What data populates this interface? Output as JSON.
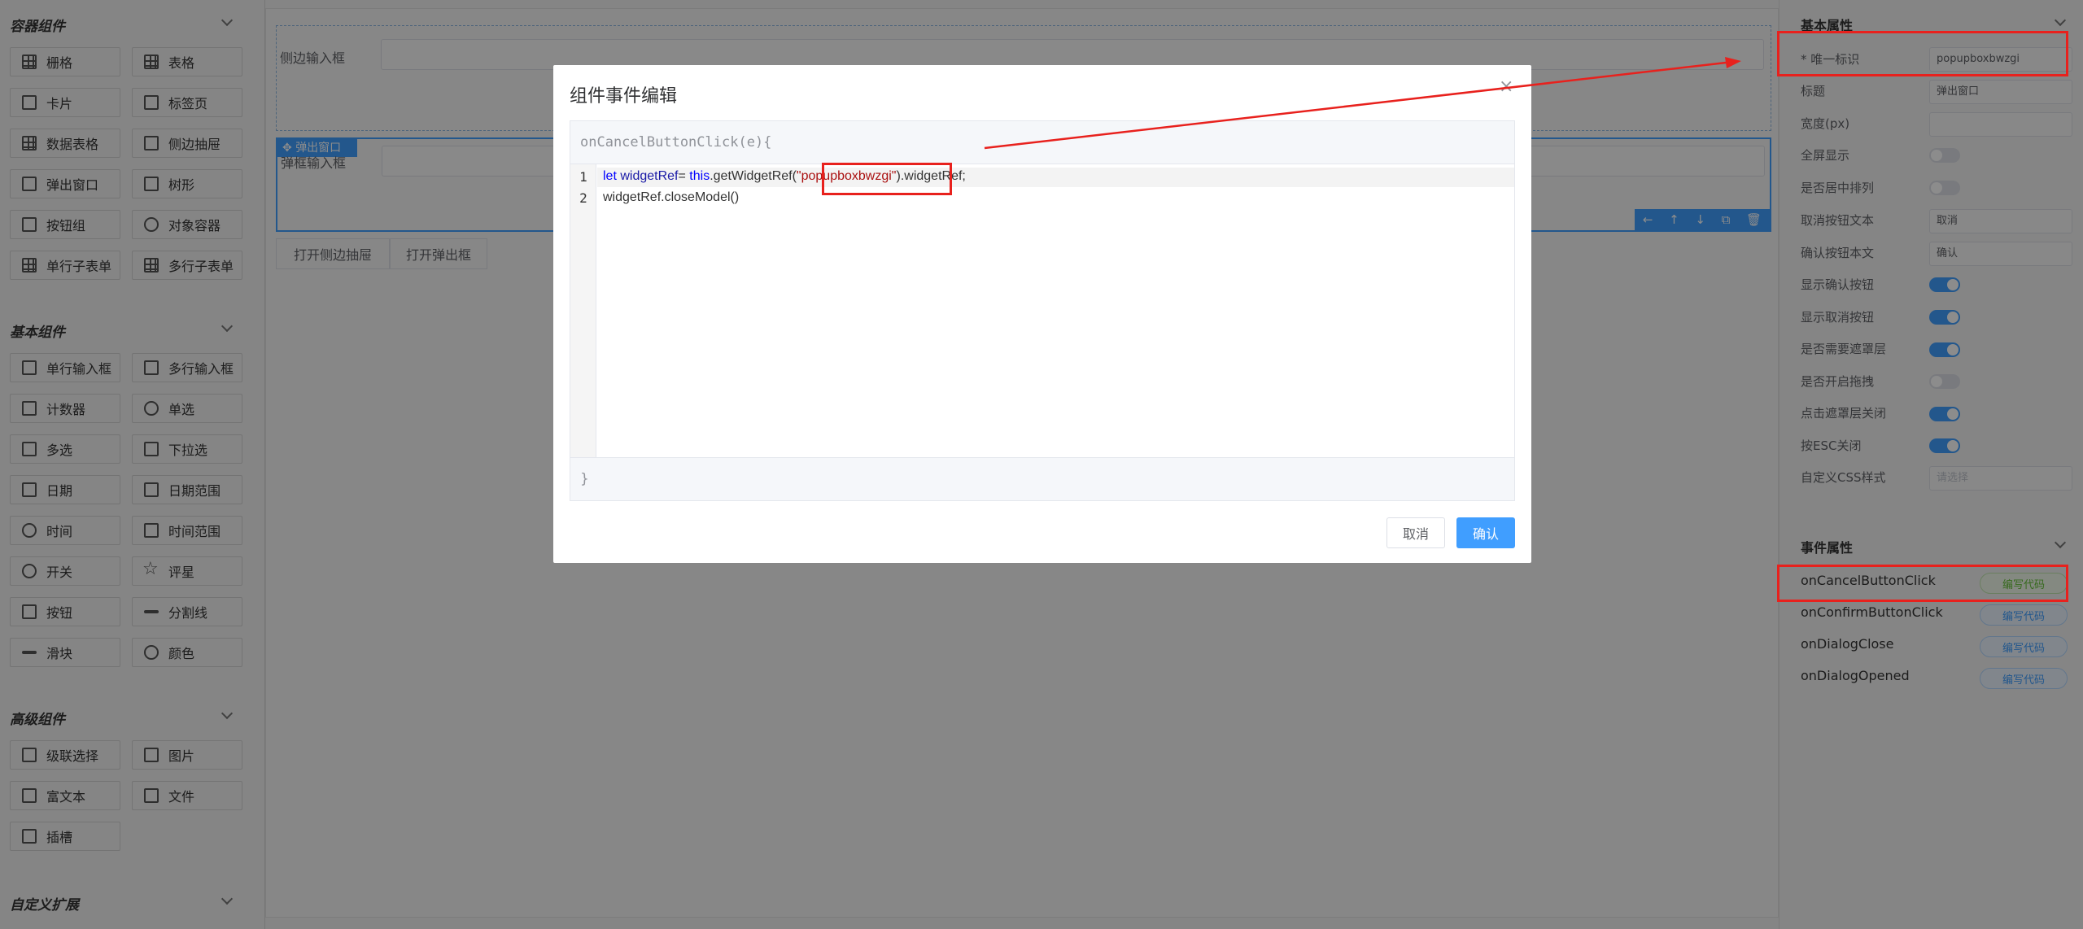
{
  "left_panel": {
    "sections": [
      {
        "title": "容器组件",
        "items": [
          "栅格",
          "表格",
          "卡片",
          "标签页",
          "数据表格",
          "侧边抽屉",
          "弹出窗口",
          "树形",
          "按钮组",
          "对象容器",
          "单行子表单",
          "多行子表单"
        ]
      },
      {
        "title": "基本组件",
        "items": [
          "单行输入框",
          "多行输入框",
          "计数器",
          "单选",
          "多选",
          "下拉选",
          "日期",
          "日期范围",
          "时间",
          "时间范围",
          "开关",
          "评星",
          "按钮",
          "分割线",
          "滑块",
          "颜色"
        ]
      },
      {
        "title": "高级组件",
        "items": [
          "级联选择",
          "图片",
          "富文本",
          "文件",
          "插槽"
        ]
      },
      {
        "title": "自定义扩展",
        "items": []
      }
    ]
  },
  "canvas": {
    "drawer_field_label": "侧边输入框",
    "popup_tag": "弹出窗口",
    "popup_field_label": "弹框输入框",
    "tools": [
      "←",
      "↑",
      "↓",
      "⧉",
      "🗑"
    ],
    "open_drawer_btn": "打开侧边抽屉",
    "open_popup_btn": "打开弹出框"
  },
  "right_panel": {
    "basic_title": "基本属性",
    "props": {
      "id_label": "* 唯一标识",
      "id_value": "popupboxbwzgi",
      "title_label": "标题",
      "title_value": "弹出窗口",
      "width_label": "宽度(px)",
      "width_value": "",
      "fullscreen_label": "全屏显示",
      "center_label": "是否居中排列",
      "cancel_text_label": "取消按钮文本",
      "cancel_text_value": "取消",
      "confirm_text_label": "确认按钮本文",
      "confirm_text_value": "确认",
      "show_confirm_label": "显示确认按钮",
      "show_cancel_label": "显示取消按钮",
      "mask_label": "是否需要遮罩层",
      "drag_label": "是否开启拖拽",
      "mask_close_label": "点击遮罩层关闭",
      "esc_label": "按ESC关闭",
      "css_label": "自定义CSS样式",
      "css_placeholder": "请选择"
    },
    "toggles": {
      "fullscreen": false,
      "center": false,
      "show_confirm": true,
      "show_cancel": true,
      "mask": true,
      "drag": false,
      "mask_close": true,
      "esc": true
    },
    "event_title": "事件属性",
    "events": [
      {
        "name": "onCancelButtonClick",
        "btn": "编写代码"
      },
      {
        "name": "onConfirmButtonClick",
        "btn": "编写代码"
      },
      {
        "name": "onDialogClose",
        "btn": "编写代码"
      },
      {
        "name": "onDialogOpened",
        "btn": "编写代码"
      }
    ]
  },
  "dialog": {
    "title": "组件事件编辑",
    "close": "×",
    "header": "onCancelButtonClick(e){",
    "line_numbers": [
      "1",
      "2"
    ],
    "code": {
      "l1_kw": "let ",
      "l1_var": "widgetRef",
      "l1_mid": "= ",
      "l1_this": "this",
      "l1_call": ".getWidgetRef(",
      "l1_str": "\"popupboxbwzgi\"",
      "l1_end": ").widgetRef;",
      "l2": "widgetRef.closeModel()"
    },
    "footer": "}",
    "cancel": "取消",
    "confirm": "确认"
  },
  "colors": {
    "accent": "#409eff",
    "highlight": "#e8211d"
  }
}
